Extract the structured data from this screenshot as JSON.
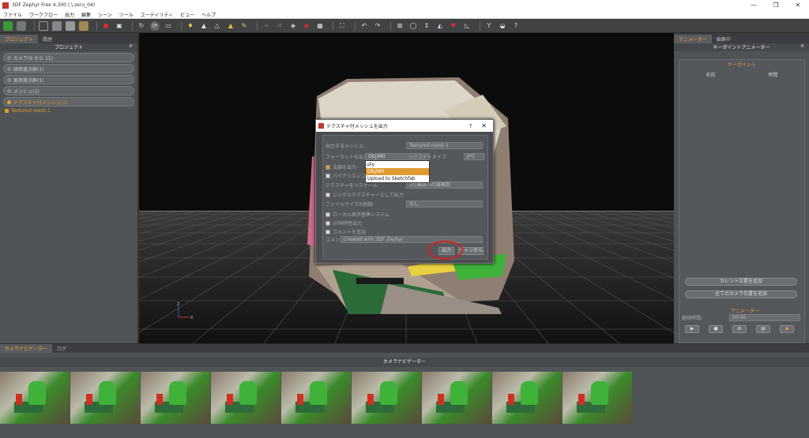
{
  "window": {
    "title": "3DF Zephyr Free 4.300 (.\\.zeru_04)",
    "minimize": "—",
    "maximize": "❐",
    "close": "✕"
  },
  "menu": [
    "ファイル",
    "ワークフロー",
    "出力",
    "編集",
    "シーン",
    "ツール",
    "ユーティリティ",
    "ビュー",
    "ヘルプ"
  ],
  "left_panel": {
    "tabs": [
      "プロジェクト",
      "履歴"
    ],
    "title": "プロジェクト",
    "close": "×",
    "groups": [
      "カメラ(9 から 11)",
      "疎密度点群(1)",
      "高密度点群(1)",
      "メッシュ(1)",
      "テクスチャ付メッシュ(1)"
    ],
    "tree_item": "Textured mesh 1"
  },
  "dialog": {
    "title": "テクスチャ付メッシュを出力",
    "help": "?",
    "close": "✕",
    "mesh_label": "出力するメッシュ:",
    "mesh_value": "Textured mesh 1",
    "format_label": "フォーマットを出力:",
    "format_value": "Obj/Mtl",
    "texture_type_label": "テクスチャタイプ:",
    "texture_type_value": "JPG",
    "format_options": [
      "ply",
      "Obj/Mtl",
      "Upload to Sketchfab"
    ],
    "opt1": "法線を出力",
    "opt2": "バイナリエンコード",
    "rescale_label": "テクスチャをリスケール",
    "rescale_value": "2の乗数への冪乗数",
    "single_texture": "シングルテクスチャーとして出力",
    "filesize_label": "ファイルサイズの制限:",
    "filesize_value": "なし",
    "local_coord": "ローカル表示基準システム",
    "utm": "UTM特性出力",
    "comment_add": "コメントを追加",
    "comment_label": "コメント",
    "comment_value": "Created with 3DF Zephyr",
    "export_btn": "出力",
    "cancel_btn": "キャンセル"
  },
  "right_panel": {
    "tabs": [
      "アニメーター",
      "編集中"
    ],
    "title": "キーポイントアニメーター",
    "close": "×",
    "section": "キーポイント",
    "col_name": "名前",
    "col_time": "時間",
    "btn_add_current": "カレント位置を追加",
    "btn_add_all": "全てのカメラ位置を追加",
    "anim_section": "アニメーター",
    "duration_label": "継続時間:",
    "duration_value": "00:00"
  },
  "bottom": {
    "tabs": [
      "カメラナビゲーター",
      "ログ"
    ],
    "title": "カメラナビゲーター",
    "thumbnail_count": 9
  },
  "axis": {
    "z": "Z",
    "x": "X"
  }
}
